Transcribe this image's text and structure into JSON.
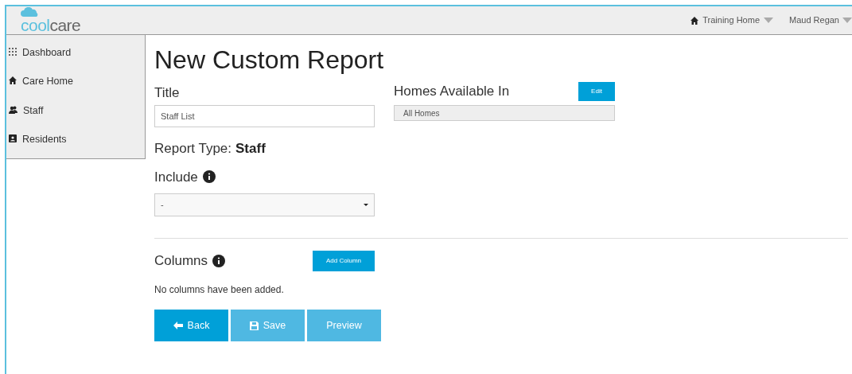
{
  "logo": {
    "part_1": "cool",
    "part_2": "care"
  },
  "header": {
    "home": "Training Home",
    "user": "Maud Regan"
  },
  "sidebar": {
    "items": [
      {
        "label": "Dashboard",
        "kind": "grid"
      },
      {
        "label": "Care Home",
        "kind": "home"
      },
      {
        "label": "Staff",
        "kind": "people"
      },
      {
        "label": "Residents",
        "kind": "card"
      }
    ]
  },
  "page": {
    "title": "New Custom Report",
    "title_field": {
      "label": "Title",
      "value": "Staff List"
    },
    "homes": {
      "label": "Homes Available In",
      "button": "Edit",
      "value": "All Homes"
    },
    "report_type": {
      "label": "Report Type:",
      "value": "Staff"
    },
    "include": {
      "label": "Include",
      "value": "-"
    },
    "columns": {
      "label": "Columns",
      "button": "Add Column",
      "empty": "No columns have been added."
    },
    "actions": [
      {
        "label": "Back",
        "kind": "back",
        "disabled": false
      },
      {
        "label": "Save",
        "kind": "save",
        "disabled": true
      },
      {
        "label": "Preview",
        "kind": "preview",
        "disabled": true
      }
    ]
  }
}
